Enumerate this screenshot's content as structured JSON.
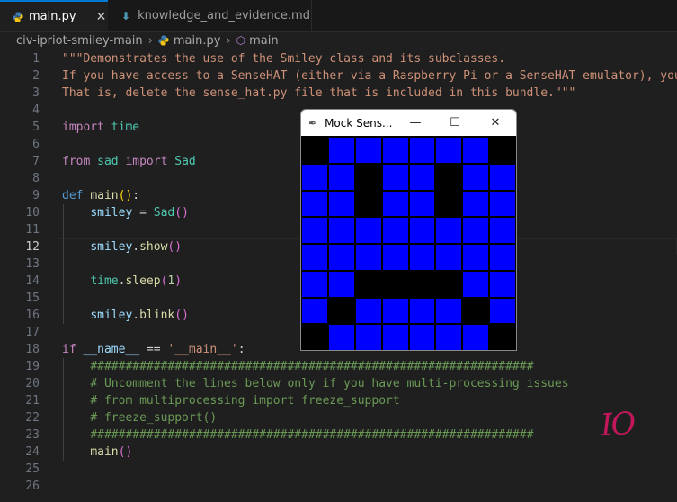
{
  "tabs": [
    {
      "label": "main.py",
      "active": true,
      "close_glyph": "✕"
    },
    {
      "label": "knowledge_and_evidence.md",
      "active": false
    }
  ],
  "breadcrumb": {
    "folder": "civ-ipriot-smiley-main",
    "file": "main.py",
    "symbol": "main"
  },
  "code_lines": [
    {
      "n": "1",
      "tokens": [
        [
          "c-str",
          "\"\"\"Demonstrates the use of the Smiley class and its subclasses."
        ]
      ]
    },
    {
      "n": "2",
      "tokens": [
        [
          "c-str",
          "If you have access to a SenseHAT (either via a Raspberry Pi or a SenseHAT emulator), you"
        ]
      ]
    },
    {
      "n": "3",
      "tokens": [
        [
          "c-str",
          "That is, delete the sense_hat.py file that is included in this bundle.\"\"\""
        ]
      ]
    },
    {
      "n": "4",
      "tokens": []
    },
    {
      "n": "5",
      "tokens": [
        [
          "c-kw",
          "import"
        ],
        [
          "c-op",
          " "
        ],
        [
          "c-cls",
          "time"
        ]
      ]
    },
    {
      "n": "6",
      "tokens": []
    },
    {
      "n": "7",
      "tokens": [
        [
          "c-kw",
          "from"
        ],
        [
          "c-op",
          " "
        ],
        [
          "c-cls",
          "sad"
        ],
        [
          "c-op",
          " "
        ],
        [
          "c-kw",
          "import"
        ],
        [
          "c-op",
          " "
        ],
        [
          "c-cls",
          "Sad"
        ]
      ]
    },
    {
      "n": "8",
      "tokens": []
    },
    {
      "n": "9",
      "tokens": [
        [
          "c-def",
          "def"
        ],
        [
          "c-op",
          " "
        ],
        [
          "c-fn",
          "main"
        ],
        [
          "c-paren",
          "()"
        ],
        [
          "c-op",
          ":"
        ]
      ]
    },
    {
      "n": "10",
      "tokens": [
        [
          "c-op",
          "    "
        ],
        [
          "c-var",
          "smiley"
        ],
        [
          "c-op",
          " = "
        ],
        [
          "c-cls",
          "Sad"
        ],
        [
          "c-paren2",
          "()"
        ]
      ]
    },
    {
      "n": "11",
      "tokens": []
    },
    {
      "n": "12",
      "tokens": [
        [
          "c-op",
          "    "
        ],
        [
          "c-var",
          "smiley"
        ],
        [
          "c-op",
          "."
        ],
        [
          "c-fn",
          "show"
        ],
        [
          "c-paren2",
          "()"
        ]
      ]
    },
    {
      "n": "13",
      "tokens": []
    },
    {
      "n": "14",
      "tokens": [
        [
          "c-op",
          "    "
        ],
        [
          "c-cls",
          "time"
        ],
        [
          "c-op",
          "."
        ],
        [
          "c-fn",
          "sleep"
        ],
        [
          "c-paren2",
          "("
        ],
        [
          "c-num",
          "1"
        ],
        [
          "c-paren2",
          ")"
        ]
      ]
    },
    {
      "n": "15",
      "tokens": []
    },
    {
      "n": "16",
      "tokens": [
        [
          "c-op",
          "    "
        ],
        [
          "c-var",
          "smiley"
        ],
        [
          "c-op",
          "."
        ],
        [
          "c-fn",
          "blink"
        ],
        [
          "c-paren2",
          "()"
        ]
      ]
    },
    {
      "n": "17",
      "tokens": []
    },
    {
      "n": "18",
      "tokens": [
        [
          "c-kw",
          "if"
        ],
        [
          "c-op",
          " "
        ],
        [
          "c-var",
          "__name__"
        ],
        [
          "c-op",
          " == "
        ],
        [
          "c-str",
          "'__main__'"
        ],
        [
          "c-op",
          ":"
        ]
      ]
    },
    {
      "n": "19",
      "tokens": [
        [
          "c-op",
          "    "
        ],
        [
          "c-cmt",
          "###############################################################"
        ]
      ]
    },
    {
      "n": "20",
      "tokens": [
        [
          "c-op",
          "    "
        ],
        [
          "c-cmt",
          "# Uncomment the lines below only if you have multi-processing issues"
        ]
      ]
    },
    {
      "n": "21",
      "tokens": [
        [
          "c-op",
          "    "
        ],
        [
          "c-cmt",
          "# from multiprocessing import freeze_support"
        ]
      ]
    },
    {
      "n": "22",
      "tokens": [
        [
          "c-op",
          "    "
        ],
        [
          "c-cmt",
          "# freeze_support()"
        ]
      ]
    },
    {
      "n": "23",
      "tokens": [
        [
          "c-op",
          "    "
        ],
        [
          "c-cmt",
          "###############################################################"
        ]
      ]
    },
    {
      "n": "24",
      "tokens": [
        [
          "c-op",
          "    "
        ],
        [
          "c-fn",
          "main"
        ],
        [
          "c-paren2",
          "()"
        ]
      ]
    },
    {
      "n": "25",
      "tokens": []
    },
    {
      "n": "26",
      "tokens": []
    }
  ],
  "current_line": "12",
  "mock_window": {
    "title": "Mock Sens...",
    "minimize_glyph": "—",
    "maximize_glyph": "☐",
    "close_glyph": "✕",
    "pixel_on_color": "#0000ff",
    "pixel_off_color": "#000000",
    "pixels": [
      [
        0,
        1,
        1,
        1,
        1,
        1,
        1,
        0
      ],
      [
        1,
        1,
        0,
        1,
        1,
        0,
        1,
        1
      ],
      [
        1,
        1,
        0,
        1,
        1,
        0,
        1,
        1
      ],
      [
        1,
        1,
        1,
        1,
        1,
        1,
        1,
        1
      ],
      [
        1,
        1,
        1,
        1,
        1,
        1,
        1,
        1
      ],
      [
        1,
        1,
        0,
        0,
        0,
        0,
        1,
        1
      ],
      [
        1,
        0,
        1,
        1,
        1,
        1,
        0,
        1
      ],
      [
        0,
        1,
        1,
        1,
        1,
        1,
        1,
        0
      ]
    ]
  },
  "annotation": "IO"
}
